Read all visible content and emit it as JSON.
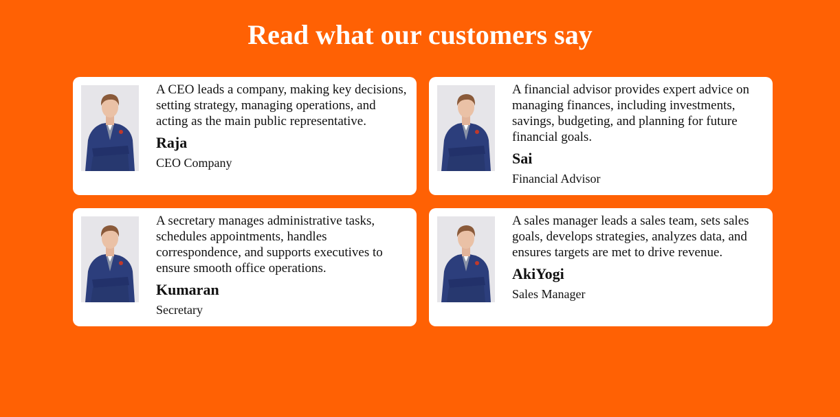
{
  "header": {
    "title": "Read what our customers say"
  },
  "colors": {
    "background": "#ff6104",
    "card": "#ffffff",
    "suit": "#2c3e7c"
  },
  "testimonials": [
    {
      "quote": "A CEO leads a company, making key decisions, setting strategy, managing operations, and acting as the main public representative.",
      "name": "Raja",
      "role": "CEO Company",
      "avatar_icon": "businessman-photo"
    },
    {
      "quote": "A financial advisor provides expert advice on managing finances, including investments, savings, budgeting, and planning for future financial goals.",
      "name": "Sai",
      "role": "Financial Advisor",
      "avatar_icon": "businessman-photo"
    },
    {
      "quote": "A secretary manages administrative tasks, schedules appointments, handles correspondence, and supports executives to ensure smooth office operations.",
      "name": "Kumaran",
      "role": "Secretary",
      "avatar_icon": "businessman-photo"
    },
    {
      "quote": "A sales manager leads a sales team, sets sales goals, develops strategies, analyzes data, and ensures targets are met to drive revenue.",
      "name": "AkiYogi",
      "role": "Sales Manager",
      "avatar_icon": "businessman-photo"
    }
  ]
}
